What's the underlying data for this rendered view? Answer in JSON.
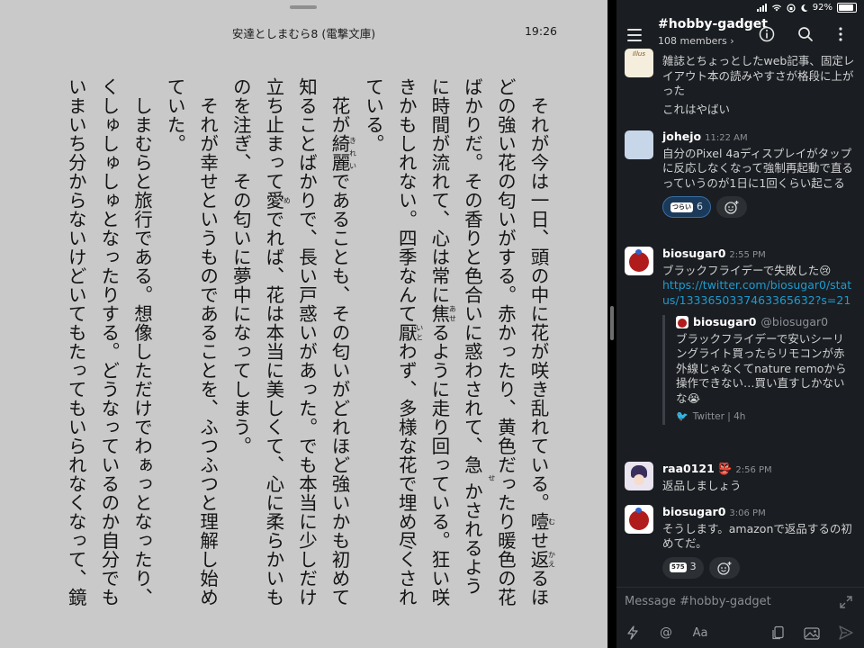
{
  "reader": {
    "title": "安達としまむら8 (電撃文庫)",
    "time": "19:26",
    "paragraphs": [
      [
        "それが今は一日、頭の中に花が咲き乱れている。",
        {
          "base": "噎",
          "ruby": "む"
        },
        "せ",
        {
          "base": "返",
          "ruby": "かえ"
        },
        "るほどの強い花の匂いがする。赤かったり、黄色だったり暖色の花ばかりだ。その香りと色合いに惑わされて、急",
        {
          "base": "",
          "ruby": "せ"
        },
        "かされるように時間が流れて、心は常に",
        {
          "base": "焦",
          "ruby": "あせ"
        },
        "るように走り回っている。狂い咲きかもしれない。四季なんて",
        {
          "base": "厭",
          "ruby": "いと"
        },
        "わず、多様な花で埋め尽くされている。"
      ],
      [
        "花が",
        {
          "base": "綺麗",
          "ruby": "きれい"
        },
        "であることも、その匂いがどれほど強いかも初めて知ることばかりで、長い戸惑いがあった。でも本当に少しだけ立ち止まって",
        {
          "base": "愛",
          "ruby": "め"
        },
        "でれば、花は本当に美しくて、心に柔らかいものを注ぎ、その匂いに夢中になってしまう。"
      ],
      [
        "それが幸せというものであることを、ふつふつと理解し始めていた。"
      ],
      [
        "しまむらと旅行である。想像しただけでわぁっとなったり、くしゅしゅしゅとなったりする。どうなっているのか自分でもいまいち分からないけどいてもたってもいられなくなって、鏡"
      ]
    ]
  },
  "status_bar": {
    "battery": "92%"
  },
  "channel": {
    "name": "#hobby-gadget",
    "members": "108 members ›"
  },
  "messages": [
    {
      "text1": "雑誌とちょっとしたweb記事、固定レイアウト本の読みやすさが格段に上がった",
      "text2": "これはやばい",
      "avatar_text": "Illus"
    },
    {
      "user": "johejo",
      "time": "11:22 AM",
      "text": "自分のPixel 4aディスプレイがタップに反応しなくなって強制再起動で直るっていうのが1日に1回くらい起こる",
      "reaction_emoji": "つらい",
      "reaction_count": "6"
    },
    {
      "user": "biosugar0",
      "time": "2:55 PM",
      "text": "ブラックフライデーで失敗した😢",
      "link": "https://twitter.com/biosugar0/status/1333650337463365632?s=21",
      "quote": {
        "name": "biosugar0",
        "handle": "@biosugar0",
        "text": "ブラックフライデーで安いシーリングライト買ったらリモコンが赤外線じゃなくてnature remoから操作できない…買い直すしかないな😭",
        "source": "Twitter | 4h"
      }
    },
    {
      "user": "raa0121",
      "badge": "👺",
      "time": "2:56 PM",
      "text": "返品しましょう"
    },
    {
      "user": "biosugar0",
      "time": "3:06 PM",
      "text": "そうします。amazonで返品するの初めてだ。",
      "reaction_emoji": "575",
      "reaction_count": "3"
    }
  ],
  "composer": {
    "placeholder": "Message #hobby-gadget"
  },
  "colors": {
    "reader_bg": "#c9c9c9",
    "slack_bg": "#1a1d21",
    "link": "#1d9bd1"
  }
}
